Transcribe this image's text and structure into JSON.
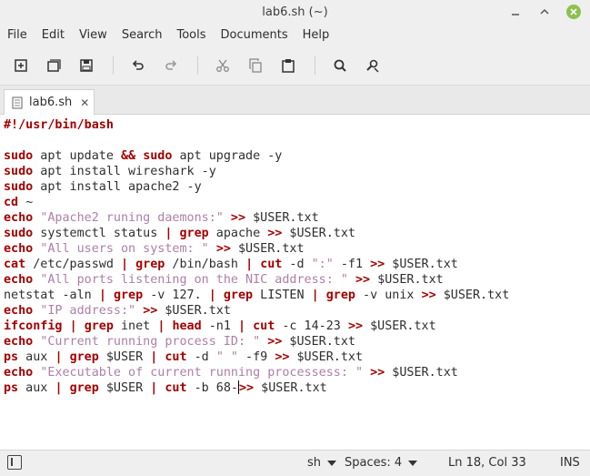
{
  "window": {
    "title": "lab6.sh (~)"
  },
  "menu": [
    "File",
    "Edit",
    "View",
    "Search",
    "Tools",
    "Documents",
    "Help"
  ],
  "tab": {
    "label": "lab6.sh"
  },
  "code_lines": [
    [
      [
        "kw",
        "#!/usr/bin/bash"
      ]
    ],
    [],
    [
      [
        "kw",
        "sudo"
      ],
      [
        "t",
        " apt update "
      ],
      [
        "kw",
        "&&"
      ],
      [
        "t",
        " "
      ],
      [
        "kw",
        "sudo"
      ],
      [
        "t",
        " apt upgrade -y"
      ]
    ],
    [
      [
        "kw",
        "sudo"
      ],
      [
        "t",
        " apt install wireshark -y"
      ]
    ],
    [
      [
        "kw",
        "sudo"
      ],
      [
        "t",
        " apt install apache2 -y"
      ]
    ],
    [
      [
        "kw",
        "cd"
      ],
      [
        "t",
        " ~"
      ]
    ],
    [
      [
        "kw",
        "echo"
      ],
      [
        "t",
        " "
      ],
      [
        "str",
        "\"Apache2 runing daemons:\""
      ],
      [
        "t",
        " "
      ],
      [
        "kw",
        ">>"
      ],
      [
        "t",
        " $USER.txt"
      ]
    ],
    [
      [
        "kw",
        "sudo"
      ],
      [
        "t",
        " systemctl status "
      ],
      [
        "kw",
        "|"
      ],
      [
        "t",
        " "
      ],
      [
        "kw",
        "grep"
      ],
      [
        "t",
        " apache "
      ],
      [
        "kw",
        ">>"
      ],
      [
        "t",
        " $USER.txt"
      ]
    ],
    [
      [
        "kw",
        "echo"
      ],
      [
        "t",
        " "
      ],
      [
        "str",
        "\"All users on system: \""
      ],
      [
        "t",
        " "
      ],
      [
        "kw",
        ">>"
      ],
      [
        "t",
        " $USER.txt"
      ]
    ],
    [
      [
        "kw",
        "cat"
      ],
      [
        "t",
        " /etc/passwd "
      ],
      [
        "kw",
        "|"
      ],
      [
        "t",
        " "
      ],
      [
        "kw",
        "grep"
      ],
      [
        "t",
        " /bin/bash "
      ],
      [
        "kw",
        "|"
      ],
      [
        "t",
        " "
      ],
      [
        "kw",
        "cut"
      ],
      [
        "t",
        " -d "
      ],
      [
        "str",
        "\":\""
      ],
      [
        "t",
        " -f1 "
      ],
      [
        "kw",
        ">>"
      ],
      [
        "t",
        " $USER.txt"
      ]
    ],
    [
      [
        "kw",
        "echo"
      ],
      [
        "t",
        " "
      ],
      [
        "str",
        "\"All ports listening on the NIC address: \""
      ],
      [
        "t",
        " "
      ],
      [
        "kw",
        ">>"
      ],
      [
        "t",
        " $USER.txt"
      ]
    ],
    [
      [
        "t",
        "netstat -aln "
      ],
      [
        "kw",
        "|"
      ],
      [
        "t",
        " "
      ],
      [
        "kw",
        "grep"
      ],
      [
        "t",
        " -v 127. "
      ],
      [
        "kw",
        "|"
      ],
      [
        "t",
        " "
      ],
      [
        "kw",
        "grep"
      ],
      [
        "t",
        " LISTEN "
      ],
      [
        "kw",
        "|"
      ],
      [
        "t",
        " "
      ],
      [
        "kw",
        "grep"
      ],
      [
        "t",
        " -v unix "
      ],
      [
        "kw",
        ">>"
      ],
      [
        "t",
        " $USER.txt"
      ]
    ],
    [
      [
        "kw",
        "echo"
      ],
      [
        "t",
        " "
      ],
      [
        "str",
        "\"IP address:\""
      ],
      [
        "t",
        " "
      ],
      [
        "kw",
        ">>"
      ],
      [
        "t",
        " $USER.txt"
      ]
    ],
    [
      [
        "kw",
        "ifconfig"
      ],
      [
        "t",
        " "
      ],
      [
        "kw",
        "|"
      ],
      [
        "t",
        " "
      ],
      [
        "kw",
        "grep"
      ],
      [
        "t",
        " inet "
      ],
      [
        "kw",
        "|"
      ],
      [
        "t",
        " "
      ],
      [
        "kw",
        "head"
      ],
      [
        "t",
        " -n1 "
      ],
      [
        "kw",
        "|"
      ],
      [
        "t",
        " "
      ],
      [
        "kw",
        "cut"
      ],
      [
        "t",
        " -c 14-23 "
      ],
      [
        "kw",
        ">>"
      ],
      [
        "t",
        " $USER.txt"
      ]
    ],
    [
      [
        "kw",
        "echo"
      ],
      [
        "t",
        " "
      ],
      [
        "str",
        "\"Current running process ID: \""
      ],
      [
        "t",
        " "
      ],
      [
        "kw",
        ">>"
      ],
      [
        "t",
        " $USER.txt"
      ]
    ],
    [
      [
        "kw",
        "ps"
      ],
      [
        "t",
        " aux "
      ],
      [
        "kw",
        "|"
      ],
      [
        "t",
        " "
      ],
      [
        "kw",
        "grep"
      ],
      [
        "t",
        " $USER "
      ],
      [
        "kw",
        "|"
      ],
      [
        "t",
        " "
      ],
      [
        "kw",
        "cut"
      ],
      [
        "t",
        " -d "
      ],
      [
        "str",
        "\" \""
      ],
      [
        "t",
        " -f9 "
      ],
      [
        "kw",
        ">>"
      ],
      [
        "t",
        " $USER.txt"
      ]
    ],
    [
      [
        "kw",
        "echo"
      ],
      [
        "t",
        " "
      ],
      [
        "str",
        "\"Executable of current running processess: \""
      ],
      [
        "t",
        " "
      ],
      [
        "kw",
        ">>"
      ],
      [
        "t",
        " $USER.txt"
      ]
    ],
    [
      [
        "kw",
        "ps"
      ],
      [
        "t",
        " aux "
      ],
      [
        "kw",
        "|"
      ],
      [
        "t",
        " "
      ],
      [
        "kw",
        "grep"
      ],
      [
        "t",
        " $USER "
      ],
      [
        "kw",
        "|"
      ],
      [
        "t",
        " "
      ],
      [
        "kw",
        "cut"
      ],
      [
        "t",
        " -b 68-"
      ],
      [
        "cursor",
        ""
      ],
      [
        "kw",
        ">>"
      ],
      [
        "t",
        " $USER.txt"
      ]
    ]
  ],
  "status": {
    "language": "sh",
    "spaces": "Spaces: 4",
    "position": "Ln 18, Col 33",
    "mode": "INS"
  },
  "colors": {
    "keyword": "#a40000",
    "string": "#ad7fa8",
    "close_button": "#8cc14f"
  },
  "icons": [
    "new-document-icon",
    "new-window-icon",
    "save-icon",
    "undo-icon",
    "redo-icon",
    "cut-icon",
    "copy-icon",
    "paste-icon",
    "search-icon",
    "replace-icon",
    "sidebar-toggle-icon"
  ]
}
